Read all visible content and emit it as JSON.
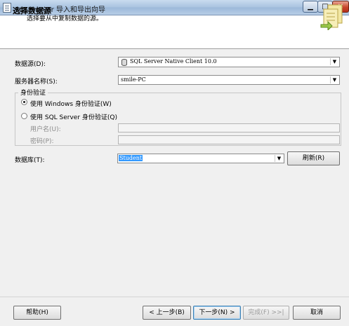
{
  "window": {
    "title": "SQL Server 导入和导出向导",
    "min_symbol": "▁",
    "max_symbol": "□",
    "close_symbol": "✕"
  },
  "header": {
    "title": "选择数据源",
    "subtitle": "选择要从中复制数据的源。"
  },
  "form": {
    "datasource_label": "数据源(D):",
    "datasource_value": "SQL Server Native Client 10.0",
    "server_label": "服务器名称(S):",
    "server_value": "smile-PC",
    "auth_group_label": "身份验证",
    "auth_windows_label": "使用 Windows 身份验证(W)",
    "auth_sql_label": "使用 SQL Server 身份验证(Q)",
    "username_label": "用户名(U):",
    "password_label": "密码(P):",
    "database_label": "数据库(T):",
    "database_value": "Student",
    "refresh_label": "刷新(R)"
  },
  "footer": {
    "help_label": "帮助(H)",
    "back_label": "< 上一步(B)",
    "next_label": "下一步(N) >",
    "finish_label": "完成(F) >>|",
    "cancel_label": "取消"
  },
  "icons": {
    "dropdown_arrow": "▼",
    "datasource_icon": "database-icon"
  },
  "colors": {
    "selection": "#3399ff",
    "close_button": "#c9462c"
  }
}
